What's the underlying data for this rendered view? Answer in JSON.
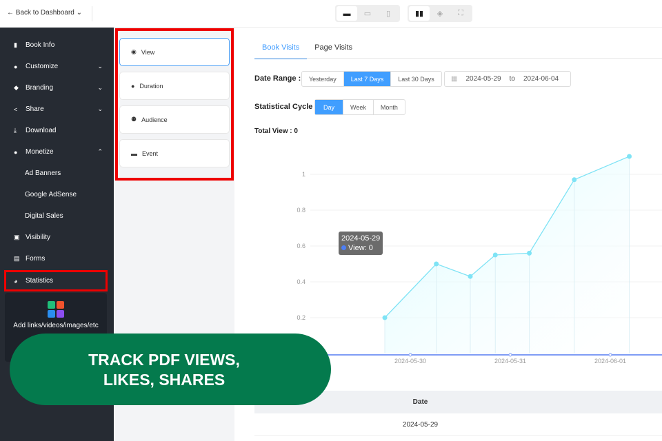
{
  "topbar": {
    "back_label": "Back to Dashboard"
  },
  "sidebar": {
    "items": [
      {
        "label": "Book Info",
        "icon": "book"
      },
      {
        "label": "Customize",
        "icon": "palette"
      },
      {
        "label": "Branding",
        "icon": "tag"
      },
      {
        "label": "Share",
        "icon": "share"
      },
      {
        "label": "Download",
        "icon": "download"
      },
      {
        "label": "Monetize",
        "icon": "money-bag"
      },
      {
        "label": "Ad Banners"
      },
      {
        "label": "Google AdSense"
      },
      {
        "label": "Digital Sales"
      },
      {
        "label": "Visibility",
        "icon": "lock"
      },
      {
        "label": "Forms",
        "icon": "file"
      },
      {
        "label": "Statistics",
        "icon": "pie-chart"
      }
    ],
    "add_label": "Add links/videos/images/etc"
  },
  "stat_menu": [
    "View",
    "Duration",
    "Audience",
    "Event"
  ],
  "tabs": [
    "Book Visits",
    "Page Visits"
  ],
  "filters": {
    "date_range_label": "Date Range :",
    "ranges": [
      "Yesterday",
      "Last 7 Days",
      "Last 30 Days"
    ],
    "start": "2024-05-29",
    "to": "to",
    "end": "2024-06-04",
    "cycle_label": "Statistical Cycle :",
    "cycles": [
      "Day",
      "Week",
      "Month"
    ]
  },
  "total_view": "Total View : 0",
  "tooltip": {
    "date": "2024-05-29",
    "value": "View: 0"
  },
  "chart_data": {
    "type": "area",
    "series": [
      {
        "name": "View",
        "x": [
          0.745,
          1.26,
          1.6,
          1.85,
          2.19,
          2.64,
          3.19
        ],
        "y": [
          0.2,
          0.5,
          0.43,
          0.55,
          0.56,
          0.97,
          1.1
        ]
      }
    ],
    "x_ticks": [
      {
        "v": 1,
        "label": "2024-05-30"
      },
      {
        "v": 2,
        "label": "2024-05-31"
      },
      {
        "v": 3,
        "label": "2024-06-01"
      }
    ],
    "y_ticks": [
      "0.2",
      "0.4",
      "0.6",
      "0.8",
      "1"
    ],
    "ylim": [
      0,
      1.1
    ],
    "color": "#7fe3f5"
  },
  "table": {
    "header": "Date",
    "rows": [
      "2024-05-29"
    ]
  },
  "banner": {
    "line1": "TRACK PDF VIEWS,",
    "line2": "LIKES, SHARES"
  }
}
